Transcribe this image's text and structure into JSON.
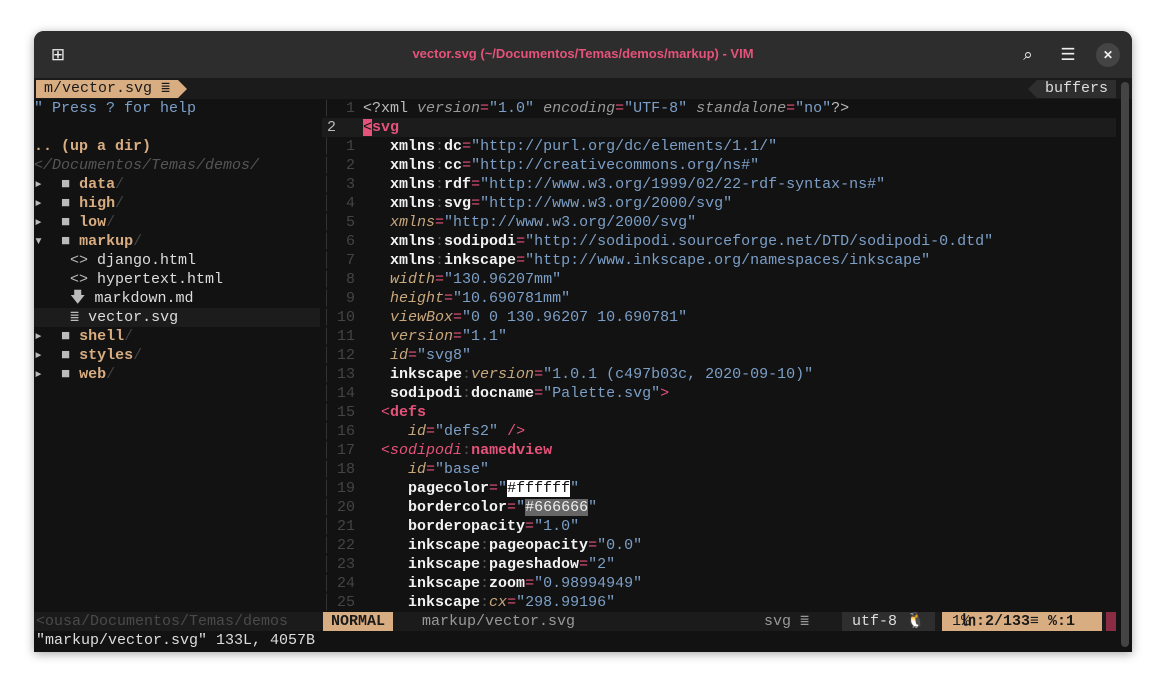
{
  "window": {
    "title": "vector.svg (~/Documentos/Temas/demos/markup) - VIM"
  },
  "tabline": {
    "current": "m/vector.svg",
    "buffers_label": "buffers"
  },
  "tree": {
    "help": "\" Press ? for help",
    "up": ".. (up a dir)",
    "cwd": "</Documentos/Temas/demos/",
    "items": [
      {
        "type": "dir",
        "arrow": "▸",
        "name": "data",
        "indent": 0
      },
      {
        "type": "dir",
        "arrow": "▸",
        "name": "high",
        "indent": 0
      },
      {
        "type": "dir",
        "arrow": "▸",
        "name": "low",
        "indent": 0
      },
      {
        "type": "dir",
        "arrow": "▾",
        "name": "markup",
        "indent": 0
      },
      {
        "type": "file",
        "icon": "<>",
        "icon_name": "code-icon",
        "name": "django.html"
      },
      {
        "type": "file",
        "icon": "<>",
        "icon_name": "code-icon",
        "name": "hypertext.html"
      },
      {
        "type": "file",
        "icon": "🡇",
        "icon_name": "markdown-icon",
        "name": "markdown.md"
      },
      {
        "type": "file",
        "icon": "≣",
        "icon_name": "file-lines-icon",
        "name": "vector.svg",
        "selected": true
      },
      {
        "type": "dir",
        "arrow": "▸",
        "name": "shell",
        "indent": 0
      },
      {
        "type": "dir",
        "arrow": "▸",
        "name": "styles",
        "indent": 0
      },
      {
        "type": "dir",
        "arrow": "▸",
        "name": "web",
        "indent": 0
      }
    ]
  },
  "editor": {
    "lines": [
      {
        "num": "1",
        "seg": [
          [
            "n",
            "<?xml "
          ],
          [
            "ni",
            "version"
          ],
          [
            "e",
            "="
          ],
          [
            "s",
            "\"1.0\" "
          ],
          [
            "ni",
            "encoding"
          ],
          [
            "e",
            "="
          ],
          [
            "s",
            "\"UTF-8\" "
          ],
          [
            "ni",
            "standalone"
          ],
          [
            "e",
            "="
          ],
          [
            "s",
            "\"no\""
          ],
          [
            "n",
            "?>"
          ]
        ]
      },
      {
        "num": "2",
        "current": true,
        "seg": [
          [
            "cursor",
            "<"
          ],
          [
            "t",
            "svg"
          ]
        ]
      },
      {
        "num": "1",
        "seg": [
          [
            "n",
            "   "
          ],
          [
            "a",
            "xmlns"
          ],
          [
            "p",
            ":"
          ],
          [
            "a",
            "dc"
          ],
          [
            "e",
            "="
          ],
          [
            "s",
            "\"http://purl.org/dc/elements/1.1/\""
          ]
        ]
      },
      {
        "num": "2",
        "seg": [
          [
            "n",
            "   "
          ],
          [
            "a",
            "xmlns"
          ],
          [
            "p",
            ":"
          ],
          [
            "a",
            "cc"
          ],
          [
            "e",
            "="
          ],
          [
            "s",
            "\"http://creativecommons.org/ns#\""
          ]
        ]
      },
      {
        "num": "3",
        "seg": [
          [
            "n",
            "   "
          ],
          [
            "a",
            "xmlns"
          ],
          [
            "p",
            ":"
          ],
          [
            "a",
            "rdf"
          ],
          [
            "e",
            "="
          ],
          [
            "s",
            "\"http://www.w3.org/1999/02/22-rdf-syntax-ns#\""
          ]
        ]
      },
      {
        "num": "4",
        "seg": [
          [
            "n",
            "   "
          ],
          [
            "a",
            "xmlns"
          ],
          [
            "p",
            ":"
          ],
          [
            "a",
            "svg"
          ],
          [
            "e",
            "="
          ],
          [
            "s",
            "\"http://www.w3.org/2000/svg\""
          ]
        ]
      },
      {
        "num": "5",
        "seg": [
          [
            "n",
            "   "
          ],
          [
            "i",
            "xmlns"
          ],
          [
            "e",
            "="
          ],
          [
            "s",
            "\"http://www.w3.org/2000/svg\""
          ]
        ]
      },
      {
        "num": "6",
        "seg": [
          [
            "n",
            "   "
          ],
          [
            "a",
            "xmlns"
          ],
          [
            "p",
            ":"
          ],
          [
            "a",
            "sodipodi"
          ],
          [
            "e",
            "="
          ],
          [
            "s",
            "\"http://sodipodi.sourceforge.net/DTD/sodipodi-0.dtd\""
          ]
        ]
      },
      {
        "num": "7",
        "seg": [
          [
            "n",
            "   "
          ],
          [
            "a",
            "xmlns"
          ],
          [
            "p",
            ":"
          ],
          [
            "a",
            "inkscape"
          ],
          [
            "e",
            "="
          ],
          [
            "s",
            "\"http://www.inkscape.org/namespaces/inkscape\""
          ]
        ]
      },
      {
        "num": "8",
        "seg": [
          [
            "n",
            "   "
          ],
          [
            "i",
            "width"
          ],
          [
            "e",
            "="
          ],
          [
            "s",
            "\"130.96207mm\""
          ]
        ]
      },
      {
        "num": "9",
        "seg": [
          [
            "n",
            "   "
          ],
          [
            "i",
            "height"
          ],
          [
            "e",
            "="
          ],
          [
            "s",
            "\"10.690781mm\""
          ]
        ]
      },
      {
        "num": "10",
        "seg": [
          [
            "n",
            "   "
          ],
          [
            "i",
            "viewBox"
          ],
          [
            "e",
            "="
          ],
          [
            "s",
            "\"0 0 130.96207 10.690781\""
          ]
        ]
      },
      {
        "num": "11",
        "seg": [
          [
            "n",
            "   "
          ],
          [
            "i",
            "version"
          ],
          [
            "e",
            "="
          ],
          [
            "s",
            "\"1.1\""
          ]
        ]
      },
      {
        "num": "12",
        "seg": [
          [
            "n",
            "   "
          ],
          [
            "i",
            "id"
          ],
          [
            "e",
            "="
          ],
          [
            "s",
            "\"svg8\""
          ]
        ]
      },
      {
        "num": "13",
        "seg": [
          [
            "n",
            "   "
          ],
          [
            "a",
            "inkscape"
          ],
          [
            "p",
            ":"
          ],
          [
            "i",
            "version"
          ],
          [
            "e",
            "="
          ],
          [
            "s",
            "\"1.0.1 (c497b03c, 2020-09-10)\""
          ]
        ]
      },
      {
        "num": "14",
        "seg": [
          [
            "n",
            "   "
          ],
          [
            "a",
            "sodipodi"
          ],
          [
            "p",
            ":"
          ],
          [
            "a",
            "docname"
          ],
          [
            "e",
            "="
          ],
          [
            "s",
            "\"Palette.svg\""
          ],
          [
            "e",
            ">"
          ]
        ]
      },
      {
        "num": "15",
        "seg": [
          [
            "n",
            "  "
          ],
          [
            "e",
            "<"
          ],
          [
            "t",
            "defs"
          ]
        ]
      },
      {
        "num": "16",
        "seg": [
          [
            "n",
            "     "
          ],
          [
            "i",
            "id"
          ],
          [
            "e",
            "="
          ],
          [
            "s",
            "\"defs2\" "
          ],
          [
            "e",
            "/>"
          ]
        ]
      },
      {
        "num": "17",
        "seg": [
          [
            "n",
            "  "
          ],
          [
            "e",
            "<"
          ],
          [
            "ti",
            "sodipodi"
          ],
          [
            "p",
            ":"
          ],
          [
            "t",
            "namedview"
          ]
        ]
      },
      {
        "num": "18",
        "seg": [
          [
            "n",
            "     "
          ],
          [
            "i",
            "id"
          ],
          [
            "e",
            "="
          ],
          [
            "s",
            "\"base\""
          ]
        ]
      },
      {
        "num": "19",
        "seg": [
          [
            "n",
            "     "
          ],
          [
            "a",
            "pagecolor"
          ],
          [
            "e",
            "="
          ],
          [
            "s",
            "\""
          ],
          [
            "hlw",
            "#ffffff"
          ],
          [
            "s",
            "\""
          ]
        ]
      },
      {
        "num": "20",
        "seg": [
          [
            "n",
            "     "
          ],
          [
            "a",
            "bordercolor"
          ],
          [
            "e",
            "="
          ],
          [
            "s",
            "\""
          ],
          [
            "hlg",
            "#666666"
          ],
          [
            "s",
            "\""
          ]
        ]
      },
      {
        "num": "21",
        "seg": [
          [
            "n",
            "     "
          ],
          [
            "a",
            "borderopacity"
          ],
          [
            "e",
            "="
          ],
          [
            "s",
            "\"1.0\""
          ]
        ]
      },
      {
        "num": "22",
        "seg": [
          [
            "n",
            "     "
          ],
          [
            "a",
            "inkscape"
          ],
          [
            "p",
            ":"
          ],
          [
            "a",
            "pageopacity"
          ],
          [
            "e",
            "="
          ],
          [
            "s",
            "\"0.0\""
          ]
        ]
      },
      {
        "num": "23",
        "seg": [
          [
            "n",
            "     "
          ],
          [
            "a",
            "inkscape"
          ],
          [
            "p",
            ":"
          ],
          [
            "a",
            "pageshadow"
          ],
          [
            "e",
            "="
          ],
          [
            "s",
            "\"2\""
          ]
        ]
      },
      {
        "num": "24",
        "seg": [
          [
            "n",
            "     "
          ],
          [
            "a",
            "inkscape"
          ],
          [
            "p",
            ":"
          ],
          [
            "a",
            "zoom"
          ],
          [
            "e",
            "="
          ],
          [
            "s",
            "\"0.98994949\""
          ]
        ]
      },
      {
        "num": "25",
        "seg": [
          [
            "n",
            "     "
          ],
          [
            "a",
            "inkscape"
          ],
          [
            "p",
            ":"
          ],
          [
            "i",
            "cx"
          ],
          [
            "e",
            "="
          ],
          [
            "s",
            "\"298.99196\""
          ]
        ]
      }
    ]
  },
  "statusline": {
    "tree_path": "<ousa/Documentos/Temas/demos",
    "mode": "NORMAL",
    "file": "markup/vector.svg",
    "filetype": "svg ≣",
    "encoding": "utf-8 🐧",
    "percent": "1%",
    "position": "㏑:2/133≡ %:1"
  },
  "cmdline": {
    "message": "\"markup/vector.svg\" 133L, 4057B"
  },
  "colors": {
    "accent": "#d9ad82",
    "tag": "#e5527a",
    "string": "#7c9fc7",
    "background": "#121212"
  }
}
